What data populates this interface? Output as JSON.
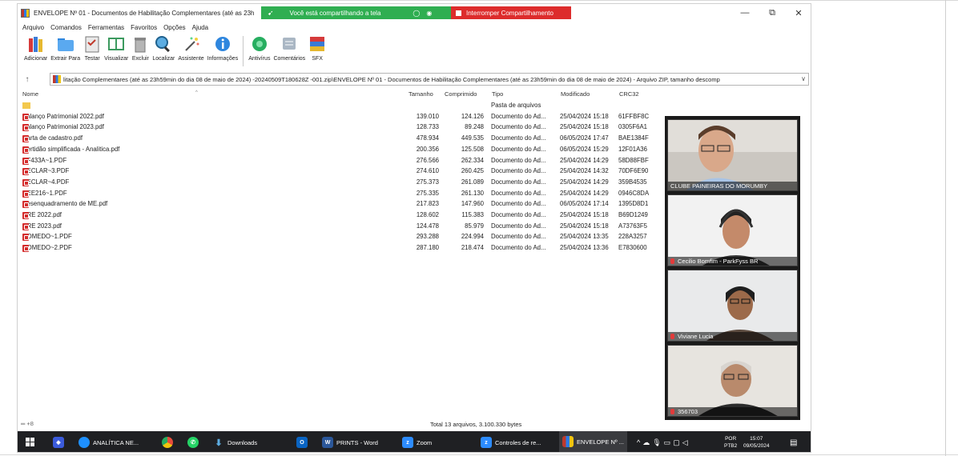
{
  "window": {
    "title": "ENVELOPE Nº 01 - Documentos de Habilitação Complementares (até as 23h",
    "minimize": "—",
    "restore": "⧉",
    "close": "✕"
  },
  "sharing": {
    "notice": "Você está compartilhando a tela",
    "ctrl1": "◯",
    "ctrl2": "◉",
    "stop_label": "Interromper Compartilhamento"
  },
  "menu": [
    "Arquivo",
    "Comandos",
    "Ferramentas",
    "Favoritos",
    "Opções",
    "Ajuda"
  ],
  "toolbar": [
    {
      "label": "Adicionar",
      "icon": "books-icon"
    },
    {
      "label": "Extrair Para",
      "icon": "folder-icon"
    },
    {
      "label": "Testar",
      "icon": "clipboard-icon"
    },
    {
      "label": "Visualizar",
      "icon": "book-icon"
    },
    {
      "label": "Excluir",
      "icon": "trash-icon"
    },
    {
      "label": "Localizar",
      "icon": "magnifier-icon"
    },
    {
      "label": "Assistente",
      "icon": "wand-icon"
    },
    {
      "label": "Informações",
      "icon": "info-icon"
    },
    {
      "label": "Antivírus",
      "icon": "antivirus-icon"
    },
    {
      "label": "Comentários",
      "icon": "comment-icon"
    },
    {
      "label": "SFX",
      "icon": "sfx-icon"
    }
  ],
  "address": {
    "up": "↑",
    "path": "litação Complementares (até as 23h59min do dia 08 de maio de 2024) -20240509T180628Z -001.zip\\ENVELOPE Nº 01 - Documentos de Habilitação Complementares (até as 23h59min do dia 08 de maio de 2024) - Arquivo ZIP, tamanho descomp",
    "dropdown": "∨"
  },
  "columns": {
    "name": "Nome",
    "size": "Tamanho",
    "compressed": "Comprimido",
    "type": "Tipo",
    "modified": "Modificado",
    "crc": "CRC32",
    "sort_marker": "^"
  },
  "files": [
    {
      "name": "..",
      "size": "",
      "compressed": "",
      "type": "Pasta de arquivos",
      "modified": "",
      "crc": "",
      "icon": "folder-icon"
    },
    {
      "name": "Balanço Patrimonial 2022.pdf",
      "size": "139.010",
      "compressed": "124.126",
      "type": "Documento do Ad...",
      "modified": "25/04/2024 15:18",
      "crc": "61FFBF8C",
      "icon": "pdf-icon"
    },
    {
      "name": "Balanço Patrimonial 2023.pdf",
      "size": "128.733",
      "compressed": "89.248",
      "type": "Documento do Ad...",
      "modified": "25/04/2024 15:18",
      "crc": "0305F6A1",
      "icon": "pdf-icon"
    },
    {
      "name": "Carta de cadastro.pdf",
      "size": "478.934",
      "compressed": "449.535",
      "type": "Documento do Ad...",
      "modified": "06/05/2024 17:47",
      "crc": "BAE1384F",
      "icon": "pdf-icon"
    },
    {
      "name": "Certidão simplificada - Analitica.pdf",
      "size": "200.356",
      "compressed": "125.508",
      "type": "Documento do Ad...",
      "modified": "06/05/2024 15:29",
      "crc": "12F01A36",
      "icon": "pdf-icon"
    },
    {
      "name": "DF433A~1.PDF",
      "size": "276.566",
      "compressed": "262.334",
      "type": "Documento do Ad...",
      "modified": "25/04/2024 14:29",
      "crc": "58D88FBF",
      "icon": "pdf-icon"
    },
    {
      "name": "DECLAR~3.PDF",
      "size": "274.610",
      "compressed": "260.425",
      "type": "Documento do Ad...",
      "modified": "25/04/2024 14:32",
      "crc": "70DF6E90",
      "icon": "pdf-icon"
    },
    {
      "name": "DECLAR~4.PDF",
      "size": "275.373",
      "compressed": "261.089",
      "type": "Documento do Ad...",
      "modified": "25/04/2024 14:29",
      "crc": "359B4535",
      "icon": "pdf-icon"
    },
    {
      "name": "DEE216~1.PDF",
      "size": "275.335",
      "compressed": "261.130",
      "type": "Documento do Ad...",
      "modified": "25/04/2024 14:29",
      "crc": "0946C8DA",
      "icon": "pdf-icon"
    },
    {
      "name": "Desenquadramento de ME.pdf",
      "size": "217.823",
      "compressed": "147.960",
      "type": "Documento do Ad...",
      "modified": "06/05/2024 17:14",
      "crc": "1395D8D1",
      "icon": "pdf-icon"
    },
    {
      "name": "DRE 2022.pdf",
      "size": "128.602",
      "compressed": "115.383",
      "type": "Documento do Ad...",
      "modified": "25/04/2024 15:18",
      "crc": "B69D1249",
      "icon": "pdf-icon"
    },
    {
      "name": "DRE 2023.pdf",
      "size": "124.478",
      "compressed": "85.979",
      "type": "Documento do Ad...",
      "modified": "25/04/2024 15:18",
      "crc": "A73763F5",
      "icon": "pdf-icon"
    },
    {
      "name": "NOMEDO~1.PDF",
      "size": "293.288",
      "compressed": "224.994",
      "type": "Documento do Ad...",
      "modified": "25/04/2024 13:35",
      "crc": "228A3257",
      "icon": "pdf-icon"
    },
    {
      "name": "NOMEDO~2.PDF",
      "size": "287.180",
      "compressed": "218.474",
      "type": "Documento do Ad...",
      "modified": "25/04/2024 13:36",
      "crc": "E7830600",
      "icon": "pdf-icon"
    }
  ],
  "participants": [
    {
      "name": "CLUBE PAINEIRAS DO MORUMBY",
      "muted": false
    },
    {
      "name": "Cecilio Bomfim - ParkFyss BR",
      "muted": true
    },
    {
      "name": "Viviane Lucia",
      "muted": true
    },
    {
      "name": "356703",
      "muted": true
    }
  ],
  "status": {
    "left": "═ +8",
    "total": "Total 13 arquivos, 3.100.330 bytes"
  },
  "taskbar": {
    "items": [
      {
        "label": "ANALÍTICA NE...",
        "icon": "edge-icon"
      },
      {
        "label": "",
        "icon": "chrome-icon"
      },
      {
        "label": "",
        "icon": "whatsapp-icon"
      },
      {
        "label": "Downloads",
        "icon": "downloads-icon"
      },
      {
        "label": "",
        "icon": "outlook-icon"
      },
      {
        "label": "PRINTS - Word",
        "icon": "word-icon"
      },
      {
        "label": "Zoom",
        "icon": "zoom-icon"
      },
      {
        "label": "Controles de re...",
        "icon": "zoom-controls-icon"
      },
      {
        "label": "ENVELOPE Nº ...",
        "icon": "winrar-icon"
      }
    ],
    "lang_top": "POR",
    "lang_bottom": "PTB2",
    "time": "15:07",
    "date": "09/05/2024"
  }
}
